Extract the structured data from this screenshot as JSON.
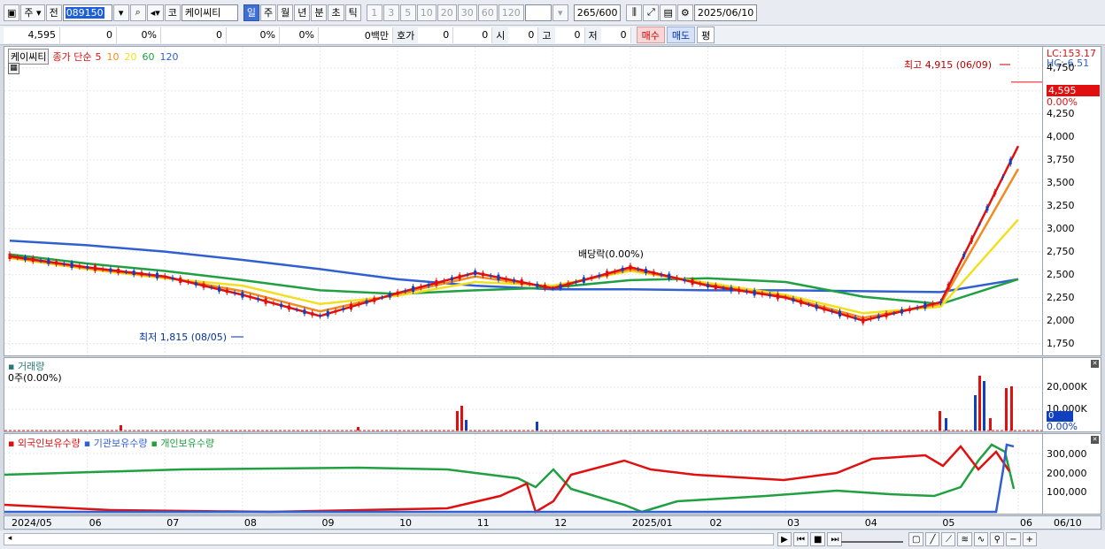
{
  "toolbar": {
    "market_type": "주",
    "prev_label": "전",
    "code": "089150",
    "kospi_label": "코",
    "stock_name": "케이씨티",
    "periods": [
      "일",
      "주",
      "월",
      "년",
      "분",
      "초",
      "틱"
    ],
    "selected_period": "일",
    "intervals": [
      "1",
      "3",
      "5",
      "10",
      "20",
      "30",
      "60",
      "120"
    ],
    "count_display": "265",
    "count_total": "/600",
    "date": "2025/06/10"
  },
  "quote": {
    "price": "4,595",
    "change": "0",
    "change_pct": "0%",
    "volume": "0",
    "vol_pct1": "0%",
    "vol_pct2": "0%",
    "amount": "0백만",
    "hoga_label": "호가",
    "hoga1": "0",
    "hoga2": "0",
    "open_label": "시",
    "open": "0",
    "high_label": "고",
    "high": "0",
    "low_label": "저",
    "low": "0",
    "buy_label": "매수",
    "sell_label": "매도",
    "eval_label": "평"
  },
  "price_panel": {
    "name_tag": "케이씨티",
    "ma_legend_prefix": "종가 단순",
    "ma_periods": [
      "5",
      "10",
      "20",
      "60",
      "120"
    ],
    "ma_colors": [
      "#e01010",
      "#f08c1e",
      "#f0e020",
      "#20a040",
      "#3060d0"
    ],
    "lc": "LC:153.17",
    "hc": "HC:-6.51",
    "current_price": "4,595",
    "current_pct": "0.00%",
    "high_annot": "최고 4,915 (06/09)",
    "low_annot": "최저 1,815 (08/05)",
    "dividend_annot": "배당락(0.00%)",
    "yticks": [
      "4,750",
      "4,500",
      "4,250",
      "4,000",
      "3,750",
      "3,500",
      "3,250",
      "3,000",
      "2,750",
      "2,500",
      "2,250",
      "2,000",
      "1,750"
    ]
  },
  "volume_panel": {
    "title": "거래량",
    "sub": "0주(0.00%)",
    "yticks": [
      "20,000K",
      "10,000K"
    ],
    "current": "0",
    "current_pct": "0.00%"
  },
  "holding_panel": {
    "legend": [
      "외국인보유수량",
      "기관보유수량",
      "개인보유수량"
    ],
    "legend_colors": [
      "#e01010",
      "#3060d0",
      "#20a040"
    ],
    "yticks": [
      "300,000",
      "200,000",
      "100,000"
    ]
  },
  "xaxis": {
    "labels": [
      "2024/05",
      "06",
      "07",
      "08",
      "09",
      "10",
      "11",
      "12",
      "2025/01",
      "02",
      "03",
      "04",
      "05",
      "06",
      "06/10"
    ]
  },
  "chart_data": {
    "type": "line",
    "title": "",
    "x": [
      "2024/05",
      "06",
      "07",
      "08",
      "09",
      "10",
      "11",
      "12",
      "2025/01",
      "02",
      "03",
      "04",
      "05",
      "06"
    ],
    "series": [
      {
        "name": "5",
        "values": [
          2700,
          2580,
          2480,
          2280,
          2050,
          2300,
          2520,
          2350,
          2580,
          2380,
          2250,
          2000,
          2200,
          3900
        ]
      },
      {
        "name": "10",
        "values": [
          2690,
          2570,
          2470,
          2320,
          2100,
          2290,
          2480,
          2360,
          2560,
          2390,
          2260,
          2030,
          2180,
          3650
        ]
      },
      {
        "name": "20",
        "values": [
          2680,
          2560,
          2460,
          2380,
          2180,
          2270,
          2420,
          2380,
          2540,
          2410,
          2280,
          2080,
          2150,
          3100
        ]
      },
      {
        "name": "60",
        "values": [
          2720,
          2620,
          2540,
          2440,
          2330,
          2290,
          2330,
          2360,
          2440,
          2460,
          2420,
          2260,
          2180,
          2450
        ]
      },
      {
        "name": "120",
        "values": [
          2870,
          2820,
          2750,
          2660,
          2560,
          2450,
          2380,
          2340,
          2340,
          2330,
          2330,
          2320,
          2310,
          2450
        ]
      }
    ],
    "ylim": [
      1650,
      4950
    ]
  }
}
